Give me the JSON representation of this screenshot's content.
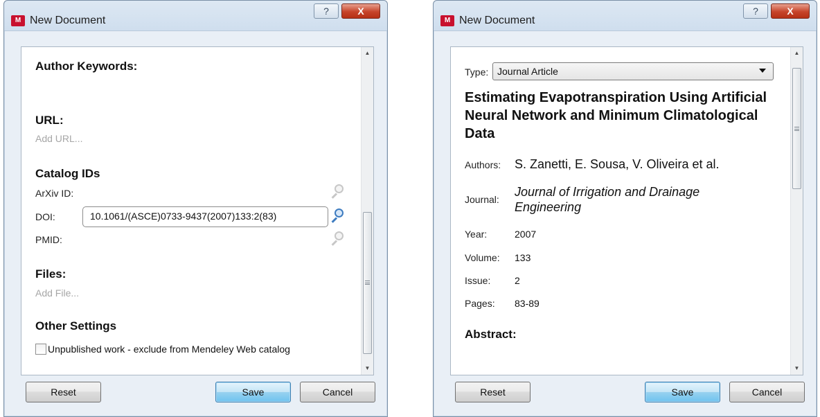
{
  "dialog_left": {
    "title": "New Document",
    "app_icon": "mendeley-icon",
    "help_glyph": "?",
    "close_glyph": "X",
    "author_keywords_heading": "Author Keywords:",
    "url_heading": "URL:",
    "url_placeholder": "Add URL...",
    "catalog_heading": "Catalog IDs",
    "arxiv_label": "ArXiv ID:",
    "doi_label": "DOI:",
    "doi_value": "10.1061/(ASCE)0733-9437(2007)133:2(83)",
    "pmid_label": "PMID:",
    "files_heading": "Files:",
    "files_placeholder": "Add File...",
    "other_settings_heading": "Other Settings",
    "unpublished_label": "Unpublished work - exclude from Mendeley Web catalog",
    "unpublished_checked": false,
    "reset_label": "Reset",
    "save_label": "Save",
    "cancel_label": "Cancel"
  },
  "dialog_right": {
    "title": "New Document",
    "app_icon": "mendeley-icon",
    "help_glyph": "?",
    "close_glyph": "X",
    "type_label": "Type:",
    "type_value": "Journal Article",
    "document_title": "Estimating Evapotranspiration Using Artificial Neural Network and Minimum Climatological Data",
    "authors_label": "Authors:",
    "authors_value": "S. Zanetti, E. Sousa, V. Oliveira et al.",
    "journal_label": "Journal:",
    "journal_value": "Journal of Irrigation and Drainage Engineering",
    "year_label": "Year:",
    "year_value": "2007",
    "volume_label": "Volume:",
    "volume_value": "133",
    "issue_label": "Issue:",
    "issue_value": "2",
    "pages_label": "Pages:",
    "pages_value": "83-89",
    "abstract_heading": "Abstract:",
    "reset_label": "Reset",
    "save_label": "Save",
    "cancel_label": "Cancel"
  },
  "colors": {
    "accent": "#6ec3ef",
    "close_button": "#c6442a",
    "placeholder_text": "#a6a6a6"
  }
}
